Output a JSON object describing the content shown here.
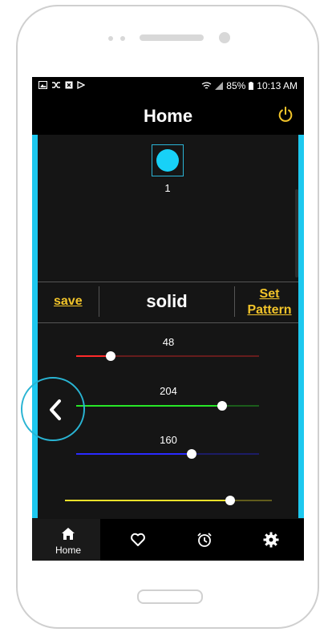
{
  "status_bar": {
    "battery": "85%",
    "time": "10:13 AM"
  },
  "header": {
    "title": "Home"
  },
  "light": {
    "number": "1",
    "color": "#18d1f7"
  },
  "controls": {
    "save_label": "save",
    "pattern_name": "solid",
    "set_pattern_line1": "Set",
    "set_pattern_line2": "Pattern"
  },
  "sliders": {
    "red": {
      "value": "48",
      "color": "#ff2a2a",
      "fraction": 0.19
    },
    "green": {
      "value": "204",
      "color": "#27e627",
      "fraction": 0.8
    },
    "blue": {
      "value": "160",
      "color": "#2a2aff",
      "fraction": 0.63
    },
    "brightness": {
      "color": "#f2e12a",
      "fraction": 0.8
    }
  },
  "bottom_nav": {
    "home_label": "Home",
    "items": [
      "home-icon",
      "heart-icon",
      "alarm-icon",
      "gear-icon"
    ]
  }
}
